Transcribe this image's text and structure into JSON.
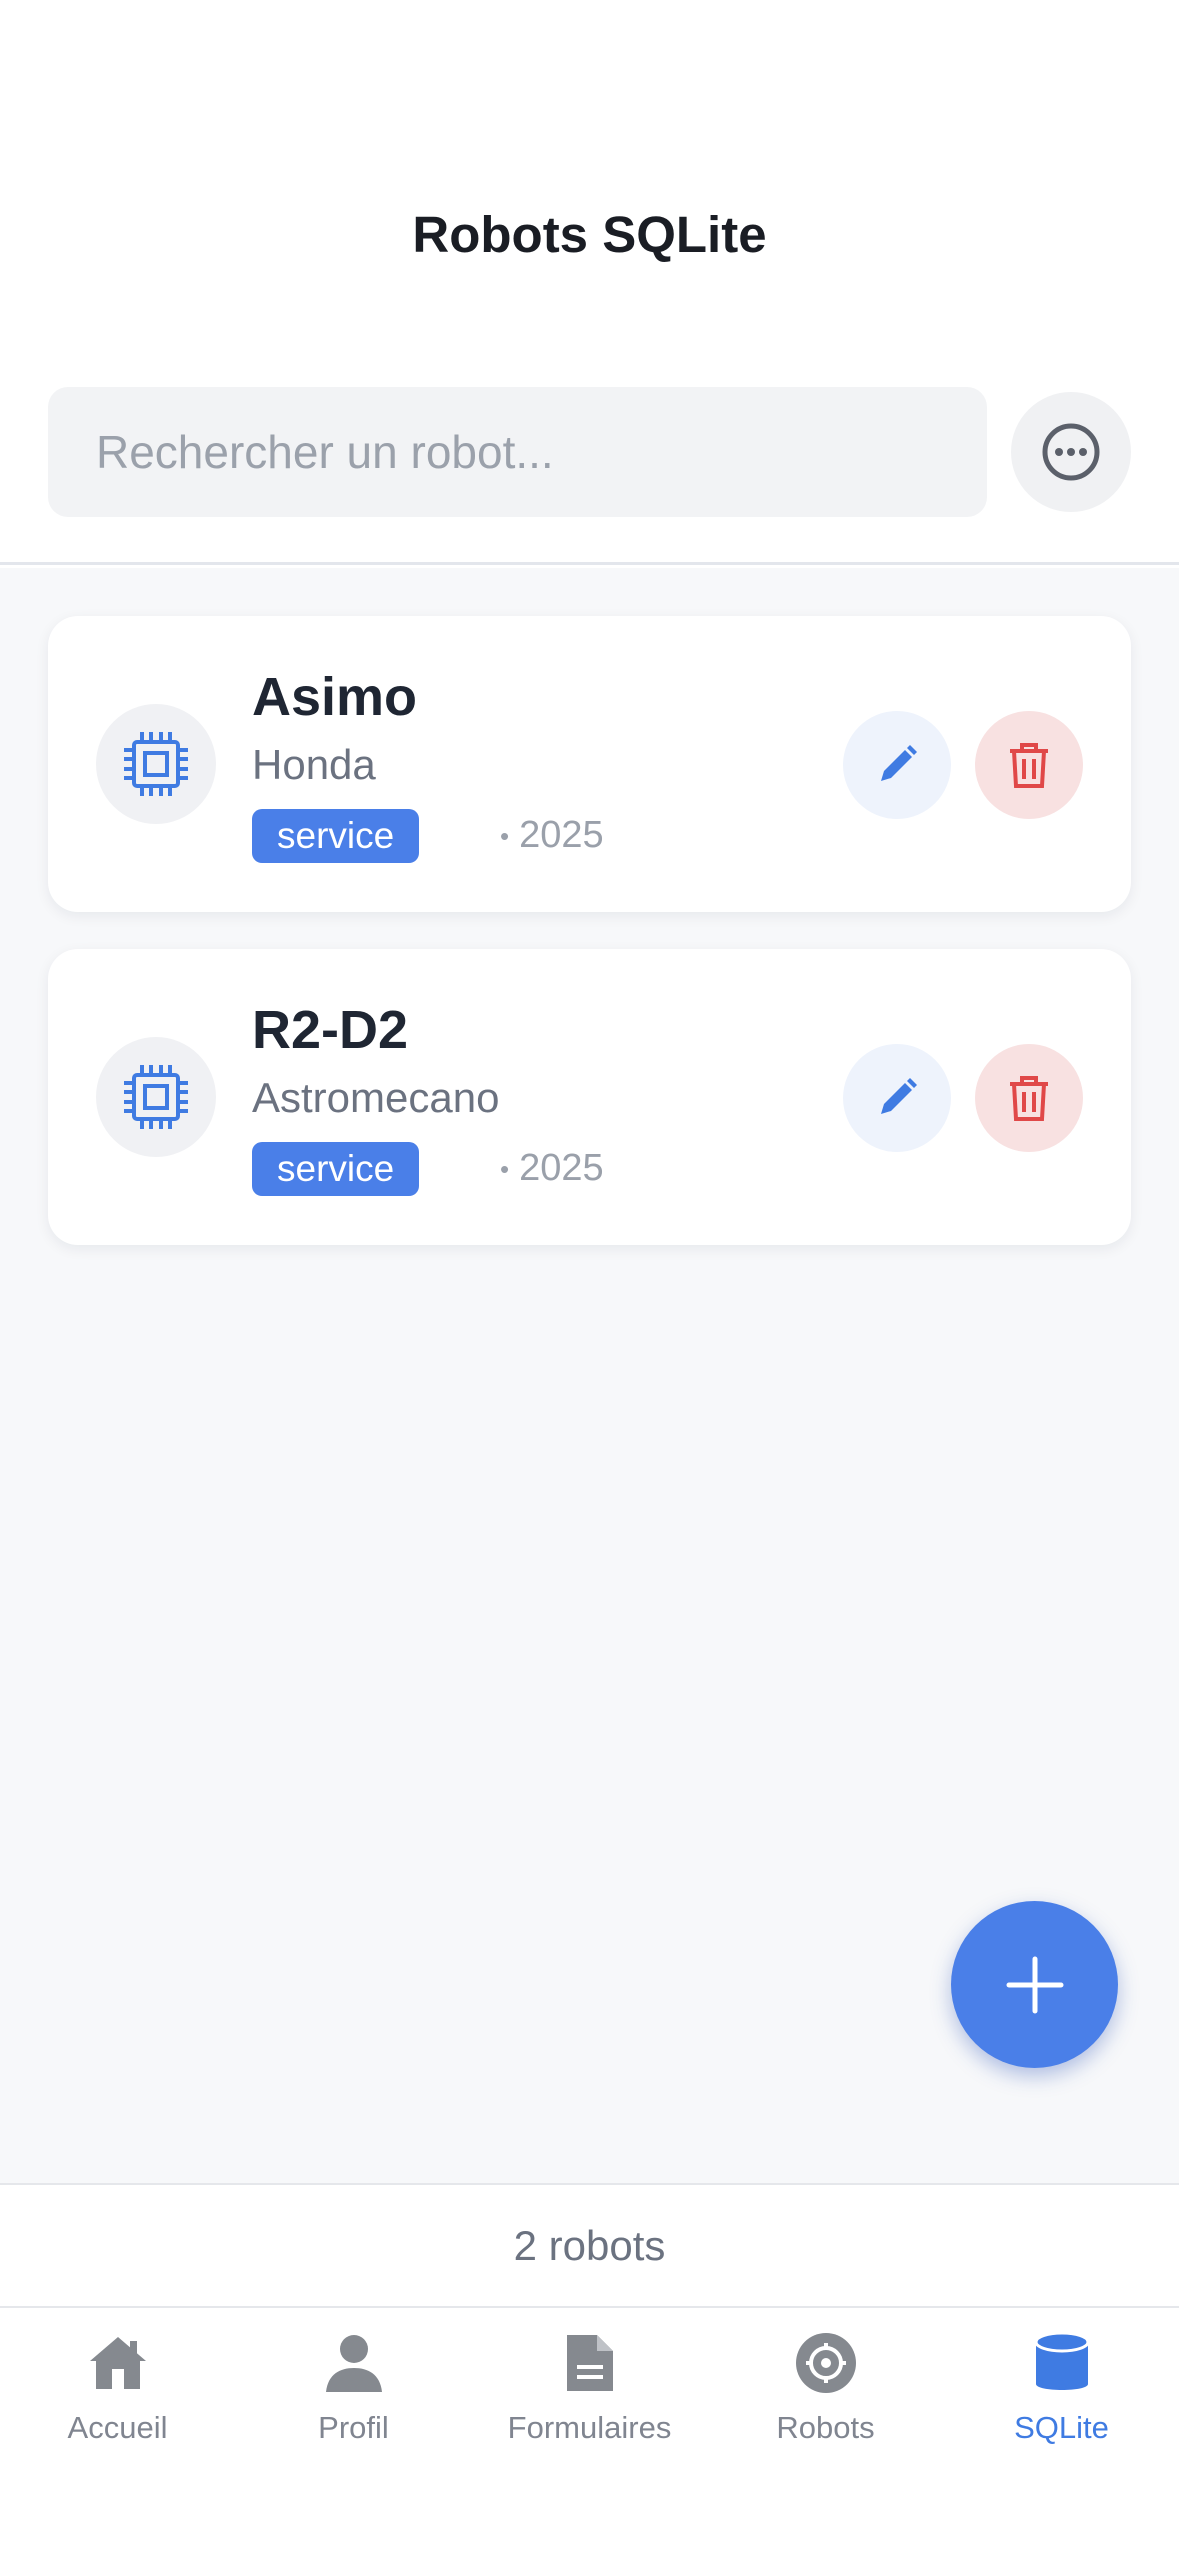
{
  "header": {
    "title": "Robots SQLite",
    "search_placeholder": "Rechercher un robot..."
  },
  "robots": [
    {
      "name": "Asimo",
      "maker": "Honda",
      "tag": "service",
      "year": "2025"
    },
    {
      "name": "R2-D2",
      "maker": "Astromecano",
      "tag": "service",
      "year": "2025"
    }
  ],
  "footer": {
    "count_text": "2 robots"
  },
  "tabs": [
    {
      "label": "Accueil",
      "icon": "home-icon"
    },
    {
      "label": "Profil",
      "icon": "person-icon"
    },
    {
      "label": "Formulaires",
      "icon": "document-icon"
    },
    {
      "label": "Robots",
      "icon": "robot-gear-icon"
    },
    {
      "label": "SQLite",
      "icon": "database-icon"
    }
  ],
  "colors": {
    "accent": "#4a7fe8",
    "delete": "#e04848",
    "background": "#f7f8fa",
    "active_tab": "#3f7be2"
  },
  "active_tab": "SQLite"
}
